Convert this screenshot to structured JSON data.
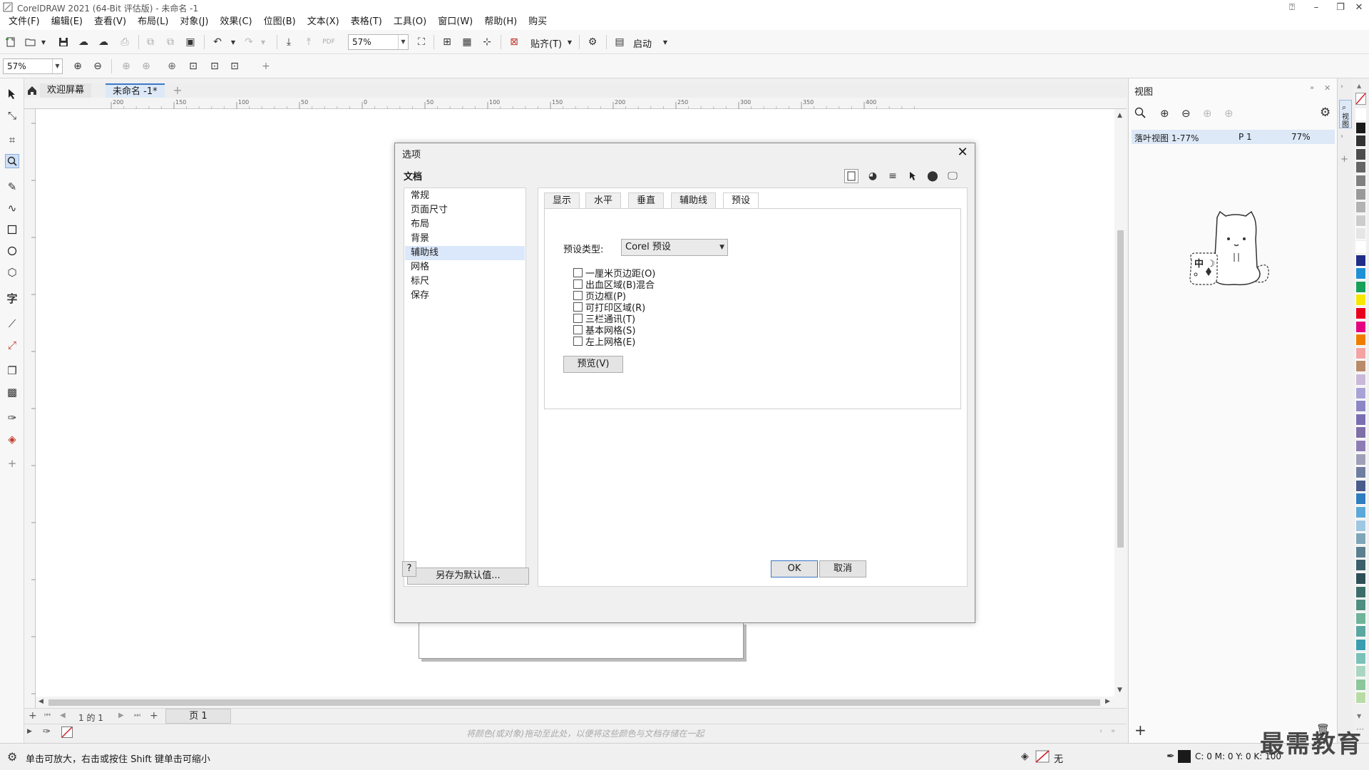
{
  "window": {
    "title": "CorelDRAW 2021 (64-Bit 评估版) - 未命名 -1",
    "controls": [
      "minimize-icon",
      "restore-icon",
      "close-icon"
    ]
  },
  "menu": [
    "文件(F)",
    "编辑(E)",
    "查看(V)",
    "布局(L)",
    "对象(J)",
    "效果(C)",
    "位图(B)",
    "文本(X)",
    "表格(T)",
    "工具(O)",
    "窗口(W)",
    "帮助(H)",
    "购买"
  ],
  "toolbar": {
    "zoom_value": "57%",
    "snap_label": "贴齐(T)",
    "launch_label": "启动"
  },
  "toolbar2": {
    "zoom_value": "57%"
  },
  "doc_tabs": {
    "welcome": "欢迎屏幕",
    "document": "未命名 -1*"
  },
  "ruler_labels": [
    "200",
    "150",
    "100",
    "50",
    "0",
    "50",
    "100",
    "150",
    "200",
    "250",
    "300",
    "350",
    "400"
  ],
  "page_nav": {
    "page_counter": "1 的 1",
    "page_tab": "页 1"
  },
  "color_tray_hint": "将颜色(或对象)拖动至此处，以便将这些颜色与文档存储在一起",
  "status": {
    "message": "单击可放大，右击或按住 Shift 键单击可缩小",
    "fill_label": "无",
    "color_readout": "C: 0 M: 0 Y: 0 K: 100"
  },
  "docker": {
    "title": "视图",
    "side_tab": "视图",
    "view_row": {
      "name": "落叶视图 1-77%",
      "page": "P 1",
      "zoom": "77%"
    },
    "cat_sticker_text": "中 ☽"
  },
  "dialog": {
    "title": "选项",
    "section": "文档",
    "categories": [
      "常规",
      "页面尺寸",
      "布局",
      "背景",
      "辅助线",
      "网格",
      "标尺",
      "保存"
    ],
    "selected_category": "辅助线",
    "save_default": "另存为默认值...",
    "tabs": [
      "显示",
      "水平",
      "垂直",
      "辅助线",
      "预设"
    ],
    "active_tab": "预设",
    "preset_type_label": "预设类型:",
    "preset_type_value": "Corel 预设",
    "checkboxes": [
      "一厘米页边距(O)",
      "出血区域(B)混合",
      "页边框(P)",
      "可打印区域(R)",
      "三栏通讯(T)",
      "基本网格(S)",
      "左上网格(E)"
    ],
    "preview": "预览(V)",
    "help": "?",
    "ok": "OK",
    "cancel": "取消"
  },
  "palette_colors": [
    "#ffffff",
    "#1a1a1a",
    "#333333",
    "#4d4d4d",
    "#666666",
    "#808080",
    "#999999",
    "#b3b3b3",
    "#cccccc",
    "#e6e6e6",
    "#ffffff",
    "#1f2d86",
    "#1e90d6",
    "#19a05a",
    "#f6e600",
    "#e8001c",
    "#e5007f",
    "#ef7d00",
    "#f4a3a3",
    "#b98b6a",
    "#c9b8d9",
    "#a8a3d6",
    "#8c86c7",
    "#7a6fb3",
    "#7f6fa8",
    "#8e7db5",
    "#9f9fb7",
    "#6f7da0",
    "#4a5c8a",
    "#2f7ec0",
    "#5ba8d9",
    "#9fc7e2",
    "#7fa6b8",
    "#5b7f8e",
    "#3d5f6b",
    "#2f4f57",
    "#3b6e6a",
    "#4f8f7f",
    "#6fb39a",
    "#59a7a0",
    "#3b9db0",
    "#7ac1b8",
    "#a9d6c2",
    "#8bc79b",
    "#b9dca6"
  ],
  "watermark": "最需教育"
}
